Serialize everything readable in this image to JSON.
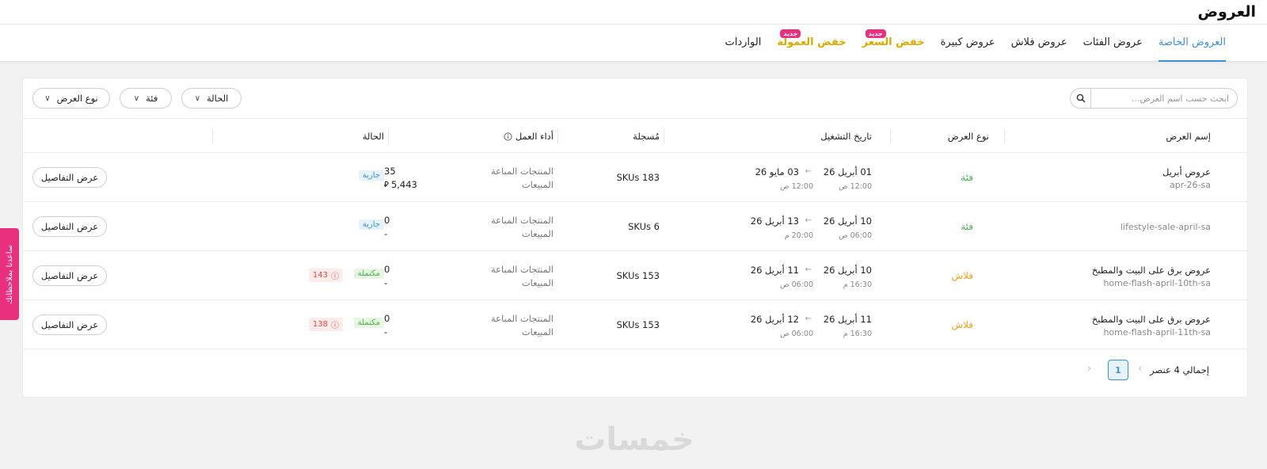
{
  "page": {
    "title": "العروض"
  },
  "tabs": [
    {
      "label": "العروض الخاصة",
      "active": true,
      "promo": false,
      "badge": ""
    },
    {
      "label": "عروض الفئات",
      "active": false,
      "promo": false,
      "badge": ""
    },
    {
      "label": "عروض فلاش",
      "active": false,
      "promo": false,
      "badge": ""
    },
    {
      "label": "عروض كبيرة",
      "active": false,
      "promo": false,
      "badge": ""
    },
    {
      "label": "خفض السعر",
      "active": false,
      "promo": true,
      "badge": "جديد"
    },
    {
      "label": "خفض العمولة",
      "active": false,
      "promo": true,
      "badge": "جديد"
    },
    {
      "label": "الواردات",
      "active": false,
      "promo": false,
      "badge": ""
    }
  ],
  "filters": {
    "search_placeholder": "ابحث حسب اسم العرض...",
    "status": "الحالة",
    "category": "فئة",
    "offer_type": "نوع العرض"
  },
  "table": {
    "headers": {
      "name": "إسم العرض",
      "type": "نوع العرض",
      "run_date": "تاريخ التشغيل",
      "registered": "مُسجلة",
      "performance": "أداء العمل",
      "status": "الحالة"
    },
    "metric_labels": {
      "sold": "المنتجات المباعة",
      "sales": "المبيعات"
    },
    "details_label": "عرض التفاصيل",
    "rows": [
      {
        "name": "عروض أبريل",
        "slug": "apr-26-sa",
        "type": "فئة",
        "type_color": "#4caf50",
        "start_date": "01 أبريل 26",
        "start_time": "12:00 ص",
        "end_date": "03 مايو 26",
        "end_time": "12:00 ص",
        "registered": "SKUs 183",
        "sold": "35",
        "sales": "5,443",
        "status": "جارية",
        "status_kind": "running",
        "warn_count": ""
      },
      {
        "name": "",
        "slug": "lifestyle-sale-april-sa",
        "type": "فئة",
        "type_color": "#4caf50",
        "start_date": "10 أبريل 26",
        "start_time": "06:00 ص",
        "end_date": "13 أبريل 26",
        "end_time": "20:00 م",
        "registered": "SKUs 6",
        "sold": "0",
        "sales": "-",
        "status": "جارية",
        "status_kind": "running",
        "warn_count": ""
      },
      {
        "name": "عروض برق على البيت والمطبخ",
        "slug": "home-flash-april-10th-sa",
        "type": "فلاش",
        "type_color": "#f0a020",
        "start_date": "10 أبريل 26",
        "start_time": "16:30 م",
        "end_date": "11 أبريل 26",
        "end_time": "06:00 ص",
        "registered": "SKUs 153",
        "sold": "0",
        "sales": "-",
        "status": "مكتملة",
        "status_kind": "done",
        "warn_count": "143"
      },
      {
        "name": "عروض برق على البيت والمطبخ",
        "slug": "home-flash-april-11th-sa",
        "type": "فلاش",
        "type_color": "#f0a020",
        "start_date": "11 أبريل 26",
        "start_time": "16:30 م",
        "end_date": "12 أبريل 26",
        "end_time": "06:00 ص",
        "registered": "SKUs 153",
        "sold": "0",
        "sales": "-",
        "status": "مكتملة",
        "status_kind": "done",
        "warn_count": "138"
      }
    ]
  },
  "pagination": {
    "total": "إجمالي 4 عنصر",
    "current_page": "1"
  },
  "side_tab": {
    "label": "ساعدنا بملاحظاتك"
  },
  "watermark": {
    "text": "خمسات"
  },
  "colors": {
    "accent": "#3d8fd6",
    "promo": "#e0a800",
    "badge_new": "#e9307f"
  }
}
